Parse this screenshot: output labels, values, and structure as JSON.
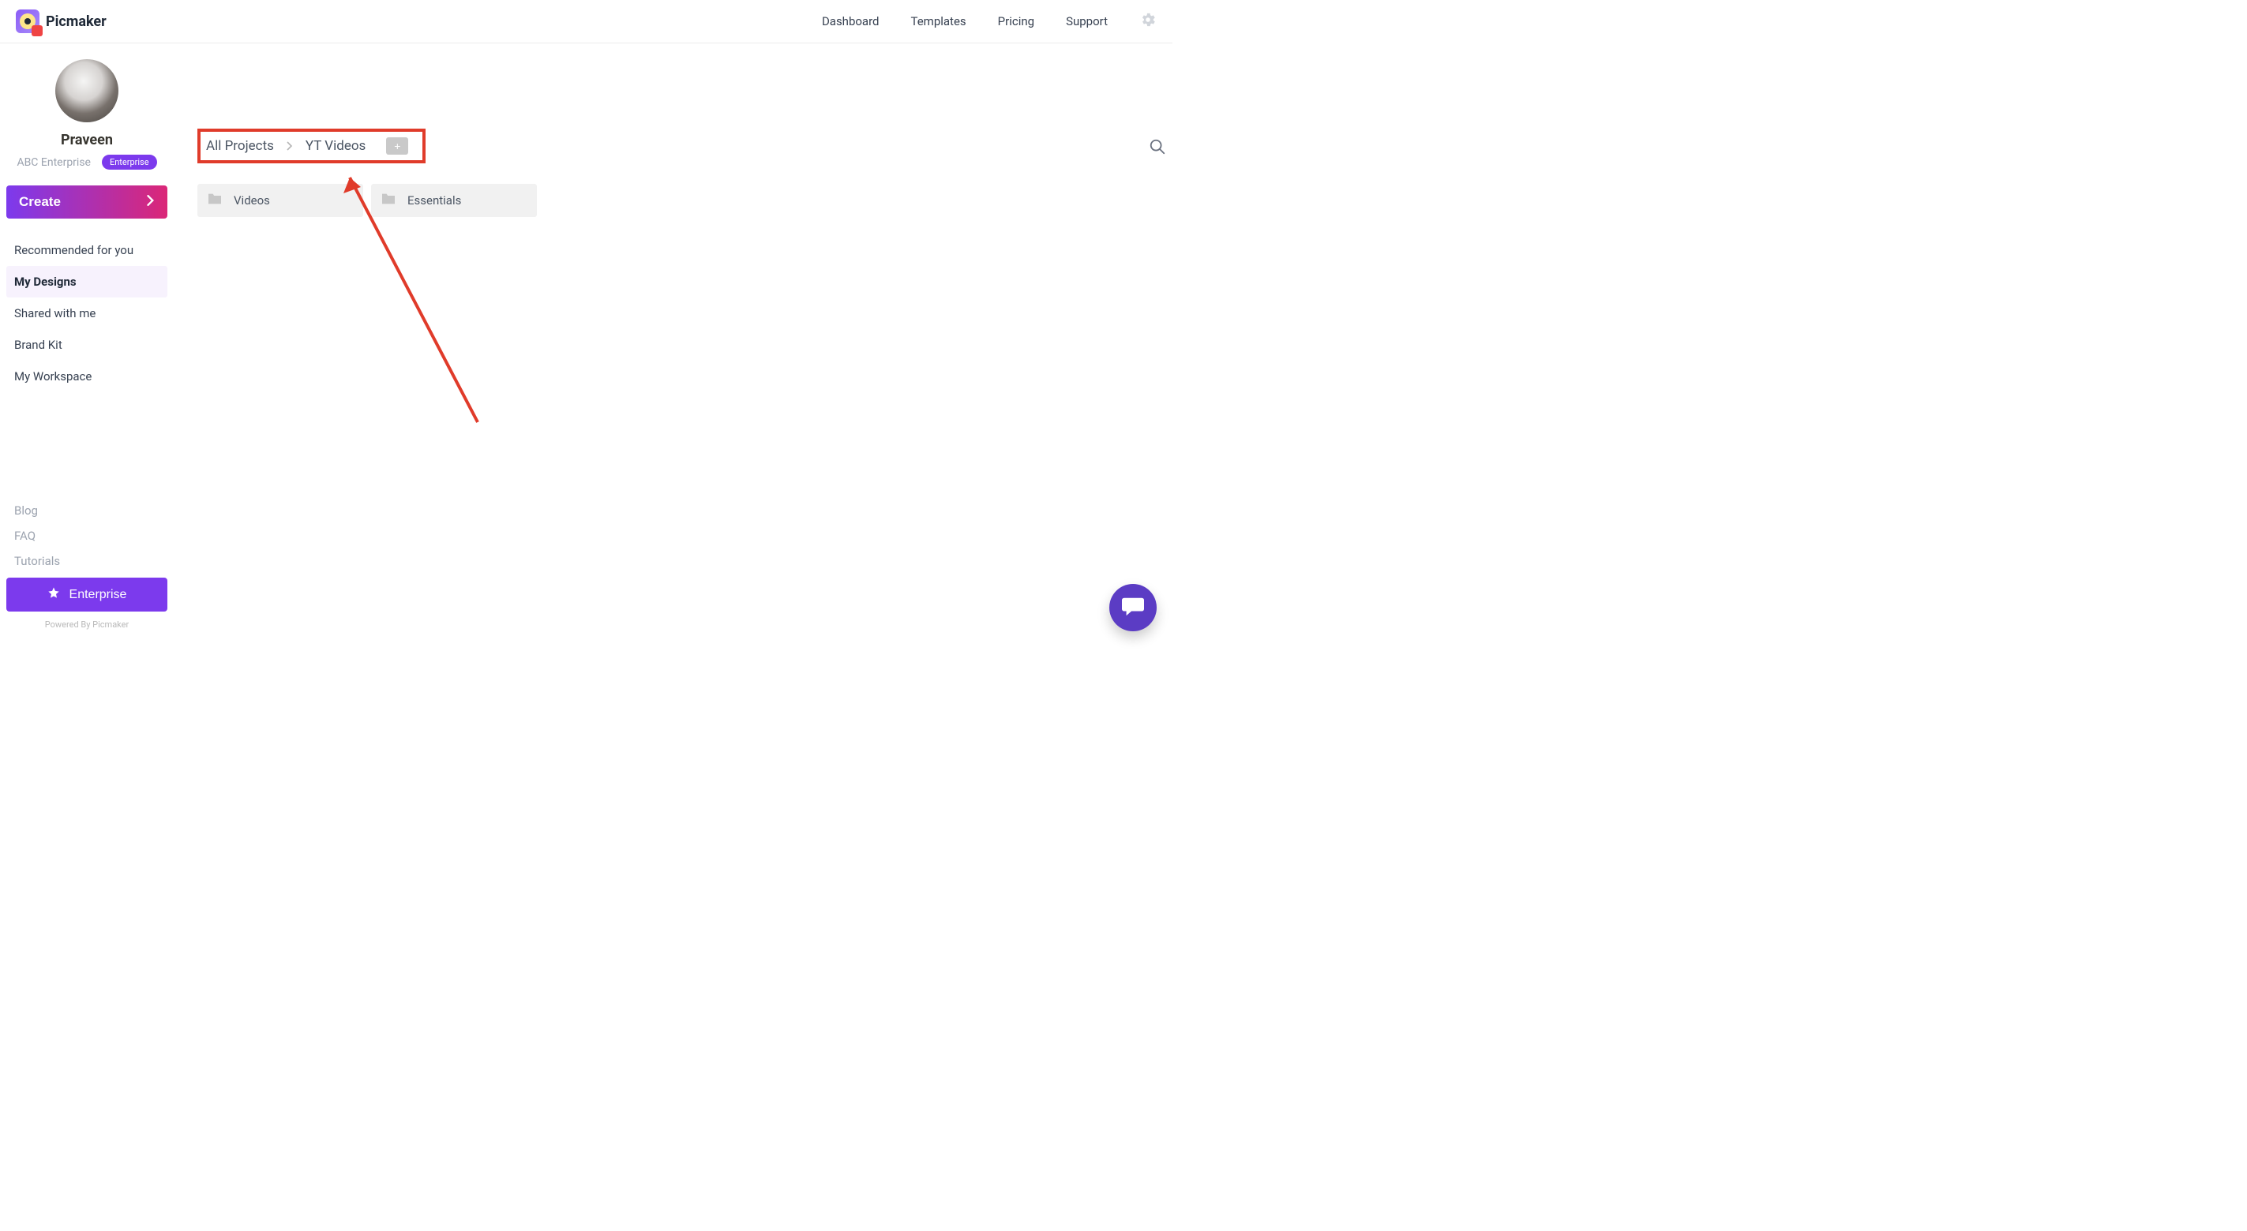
{
  "brand": {
    "name": "Picmaker"
  },
  "topnav": {
    "dashboard": "Dashboard",
    "templates": "Templates",
    "pricing": "Pricing",
    "support": "Support"
  },
  "user": {
    "name": "Praveen",
    "org": "ABC Enterprise",
    "badge": "Enterprise"
  },
  "actions": {
    "create": "Create"
  },
  "sidebar": {
    "items": [
      {
        "label": "Recommended for you"
      },
      {
        "label": "My Designs"
      },
      {
        "label": "Shared with me"
      },
      {
        "label": "Brand Kit"
      },
      {
        "label": "My Workspace"
      }
    ],
    "footer": [
      {
        "label": "Blog"
      },
      {
        "label": "FAQ"
      },
      {
        "label": "Tutorials"
      }
    ],
    "enterprise_btn": "Enterprise",
    "powered": "Powered By Picmaker"
  },
  "breadcrumb": {
    "root": "All Projects",
    "current": "YT Videos"
  },
  "folders": [
    {
      "name": "Videos"
    },
    {
      "name": "Essentials"
    }
  ]
}
